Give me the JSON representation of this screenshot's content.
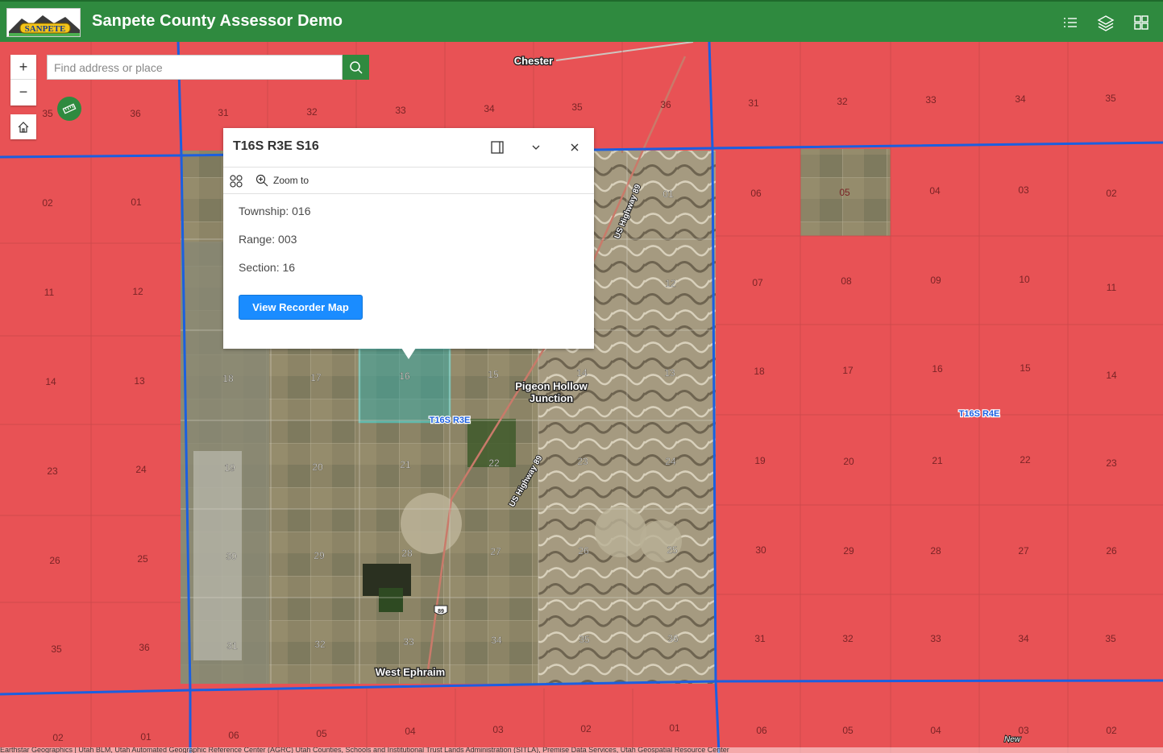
{
  "header": {
    "title": "Sanpete County Assessor Demo",
    "logo_text": "SANPETE",
    "icons": [
      "legend-list-icon",
      "layers-icon",
      "basemap-gallery-icon"
    ]
  },
  "colors": {
    "header": "#2f8a3f",
    "section_fill": "#e85255",
    "township_line": "#1b5fe0",
    "selection": "#41e6e6",
    "button": "#1a8cff"
  },
  "search": {
    "placeholder": "Find address or place"
  },
  "controls": {
    "zoom_in": "+",
    "zoom_out": "−"
  },
  "popup": {
    "title": "T16S R3E S16",
    "zoom_to_label": "Zoom to",
    "fields": [
      {
        "label": "Township",
        "value": "016",
        "text": "Township: 016"
      },
      {
        "label": "Range",
        "value": "003",
        "text": "Range: 003"
      },
      {
        "label": "Section",
        "value": "16",
        "text": "Section: 16"
      }
    ],
    "button_label": "View Recorder Map"
  },
  "map_labels": {
    "places": [
      "Chester",
      "Pigeon Hollow",
      "Junction",
      "West Ephraim",
      "New"
    ],
    "roads": [
      "US Highway 89",
      "US Highway 89",
      "89"
    ],
    "townships": [
      "T16S R3E",
      "T16S R4E"
    ]
  },
  "sections": {
    "left_col_a": [
      "35",
      "02",
      "11",
      "14",
      "23",
      "26",
      "35",
      "02"
    ],
    "left_col_b": [
      "36",
      "01",
      "12",
      "13",
      "24",
      "25",
      "36",
      "01"
    ],
    "top_row_mid": [
      "31",
      "32",
      "33",
      "34",
      "35",
      "36"
    ],
    "mid_row_18_13": [
      "18",
      "17",
      "16",
      "15",
      "14",
      "13"
    ],
    "mid_row_19_24": [
      "19",
      "20",
      "21",
      "22",
      "23",
      "24"
    ],
    "mid_row_30_25": [
      "30",
      "29",
      "28",
      "27",
      "26",
      "25"
    ],
    "mid_row_31_36": [
      "31",
      "32",
      "33",
      "34",
      "35",
      "36"
    ],
    "mid_upper": [
      "01",
      "12"
    ],
    "bottom_row_mid": [
      "06",
      "05",
      "04",
      "03",
      "02",
      "01"
    ],
    "right_row_top": [
      "31",
      "32",
      "33",
      "34",
      "35"
    ],
    "right_row_1": [
      "06",
      "05",
      "04",
      "03",
      "02"
    ],
    "right_row_2": [
      "07",
      "08",
      "09",
      "10",
      "11"
    ],
    "right_row_3": [
      "18",
      "17",
      "16",
      "15",
      "14"
    ],
    "right_row_4": [
      "19",
      "20",
      "21",
      "22",
      "23"
    ],
    "right_row_5": [
      "30",
      "29",
      "28",
      "27",
      "26"
    ],
    "right_row_6": [
      "31",
      "32",
      "33",
      "34",
      "35"
    ],
    "right_row_7": [
      "06",
      "05",
      "04",
      "03",
      "02"
    ]
  },
  "attribution": "Earthstar Geographics | Utah BLM, Utah Automated Geographic Reference Center (AGRC) Utah Counties, Schools and Institutional Trust Lands Administration (SITLA), Premise Data Services, Utah Geospatial Resource Center"
}
